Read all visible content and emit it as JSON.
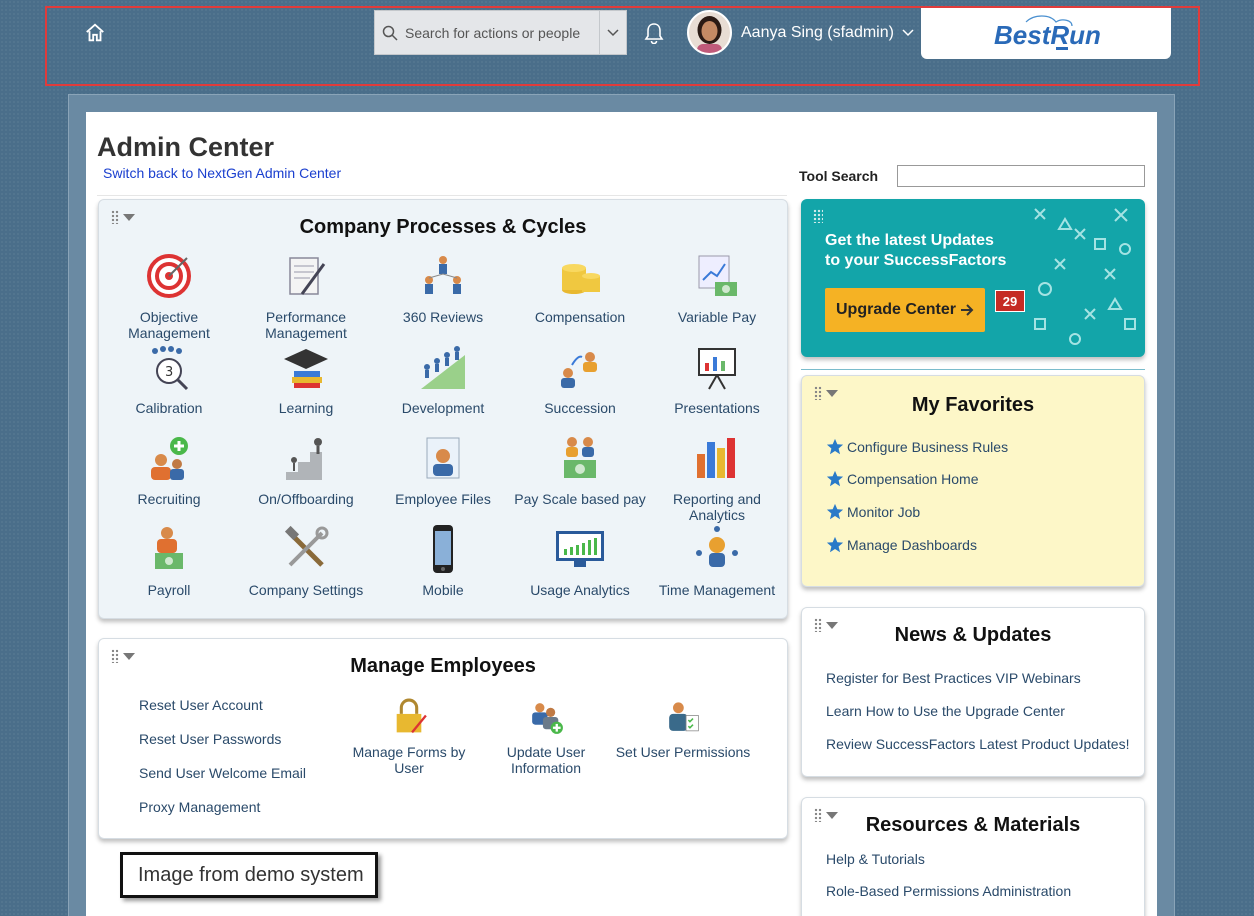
{
  "header": {
    "search_placeholder": "Search for actions or people",
    "user_name": "Aanya Sing (sfadmin)",
    "logo_text": "BestRun"
  },
  "page": {
    "title": "Admin Center",
    "switch_link": "Switch back to NextGen Admin Center",
    "tool_search_label": "Tool Search"
  },
  "company_processes": {
    "title": "Company Processes & Cycles",
    "tiles": [
      {
        "label": "Objective Management",
        "icon": "target-icon"
      },
      {
        "label": "Performance Management",
        "icon": "document-pen-icon"
      },
      {
        "label": "360 Reviews",
        "icon": "people-network-icon"
      },
      {
        "label": "Compensation",
        "icon": "coins-icon"
      },
      {
        "label": "Variable Pay",
        "icon": "chart-money-icon"
      },
      {
        "label": "Calibration",
        "icon": "calibration-icon"
      },
      {
        "label": "Learning",
        "icon": "graduation-cap-icon"
      },
      {
        "label": "Development",
        "icon": "growth-people-icon"
      },
      {
        "label": "Succession",
        "icon": "succession-icon"
      },
      {
        "label": "Presentations",
        "icon": "presentation-board-icon"
      },
      {
        "label": "Recruiting",
        "icon": "recruiting-icon"
      },
      {
        "label": "On/Offboarding",
        "icon": "stairs-icon"
      },
      {
        "label": "Employee Files",
        "icon": "employee-file-icon"
      },
      {
        "label": "Pay Scale based pay",
        "icon": "payscale-icon"
      },
      {
        "label": "Reporting and Analytics",
        "icon": "bar-chart-icon"
      },
      {
        "label": "Payroll",
        "icon": "payroll-icon"
      },
      {
        "label": "Company Settings",
        "icon": "tools-icon"
      },
      {
        "label": "Mobile",
        "icon": "mobile-phone-icon"
      },
      {
        "label": "Usage Analytics",
        "icon": "monitor-chart-icon"
      },
      {
        "label": "Time Management",
        "icon": "clock-people-icon"
      }
    ]
  },
  "manage_employees": {
    "title": "Manage Employees",
    "links": [
      "Reset User Account",
      "Reset User Passwords",
      "Send User Welcome Email",
      "Proxy Management"
    ],
    "tiles": [
      {
        "label": "Manage Forms by User",
        "icon": "lock-pen-icon"
      },
      {
        "label": "Update User Information",
        "icon": "add-user-icon"
      },
      {
        "label": "Set User Permissions",
        "icon": "user-checklist-icon"
      }
    ]
  },
  "upgrade": {
    "text_line1": "Get the latest Updates",
    "text_line2": "to your SuccessFactors",
    "button_label": "Upgrade Center",
    "badge_count": "29"
  },
  "favorites": {
    "title": "My Favorites",
    "items": [
      "Configure Business Rules",
      "Compensation Home",
      "Monitor Job",
      "Manage Dashboards"
    ]
  },
  "news": {
    "title": "News & Updates",
    "items": [
      "Register for Best Practices VIP Webinars",
      "Learn How to Use the Upgrade Center",
      "Review SuccessFactors Latest Product Updates!"
    ]
  },
  "resources": {
    "title": "Resources & Materials",
    "items": [
      "Help & Tutorials",
      "Role-Based Permissions Administration"
    ]
  },
  "demo_label": "Image from demo system"
}
